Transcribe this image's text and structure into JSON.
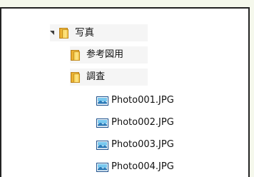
{
  "tree": {
    "root": {
      "label": "写真",
      "expanded": true,
      "children": [
        {
          "label": "参考図用",
          "type": "folder"
        },
        {
          "label": "調査",
          "type": "folder",
          "files": [
            {
              "label": "Photo001.JPG"
            },
            {
              "label": "Photo002.JPG"
            },
            {
              "label": "Photo003.JPG"
            },
            {
              "label": "Photo004.JPG"
            }
          ]
        }
      ]
    }
  },
  "icons": {
    "folder": "folder-icon",
    "image_file": "image-file-icon",
    "expand": "expanded-arrow-icon"
  },
  "colors": {
    "page_background": "#f5f8ec",
    "panel_background": "#ffffff",
    "border": "#232323",
    "folder_yellow": "#f7c948",
    "image_blue": "#2d7bb8"
  }
}
